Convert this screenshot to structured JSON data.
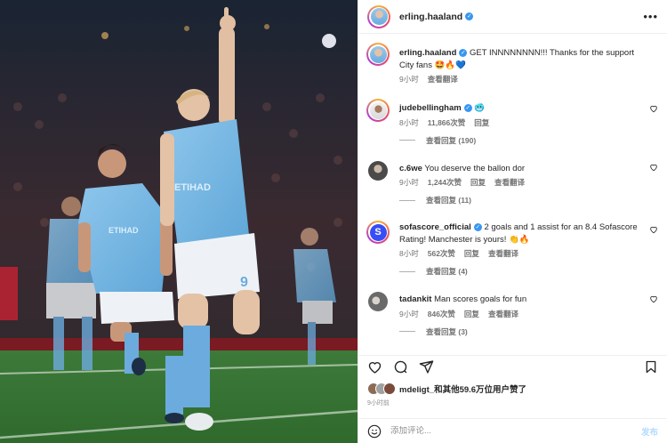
{
  "header": {
    "username": "erling.haaland",
    "more_icon": "more-horizontal-icon"
  },
  "caption": {
    "username": "erling.haaland",
    "text": "GET INNNNNNNN!!! Thanks for the support City fans 🤩🔥💙",
    "time": "9小时",
    "translate": "查看翻译"
  },
  "comments": [
    {
      "username": "judebellingham",
      "verified": true,
      "text": "🥶",
      "time": "8小时",
      "likes": "11,866次赞",
      "reply": "回复",
      "view_replies": "查看回复 (190)"
    },
    {
      "username": "c.6we",
      "verified": false,
      "text": "You deserve the ballon dor",
      "time": "9小时",
      "likes": "1,244次赞",
      "reply": "回复",
      "translate": "查看翻译",
      "view_replies": "查看回复 (11)"
    },
    {
      "username": "sofascore_official",
      "verified": true,
      "text": "2 goals and 1 assist for an 8.4 Sofascore Rating! Manchester is yours! 👏🔥",
      "time": "8小时",
      "likes": "562次赞",
      "reply": "回复",
      "translate": "查看翻译",
      "view_replies": "查看回复 (4)"
    },
    {
      "username": "tadankit",
      "verified": false,
      "text": "Man scores goals for fun",
      "time": "9小时",
      "likes": "846次赞",
      "reply": "回复",
      "translate": "查看翻译",
      "view_replies": "查看回复 (3)"
    }
  ],
  "likes": {
    "user": "mdeligt_",
    "text": "和其他59.6万位用户赞了"
  },
  "post_time": "9小时前",
  "add_comment": {
    "placeholder": "添加评论...",
    "post": "发布"
  },
  "photo": {
    "shirt_sponsor": "ETIHAD",
    "shirt_number": "9"
  },
  "colors": {
    "verified": "#3897f0",
    "city_blue": "#6cabdd"
  }
}
